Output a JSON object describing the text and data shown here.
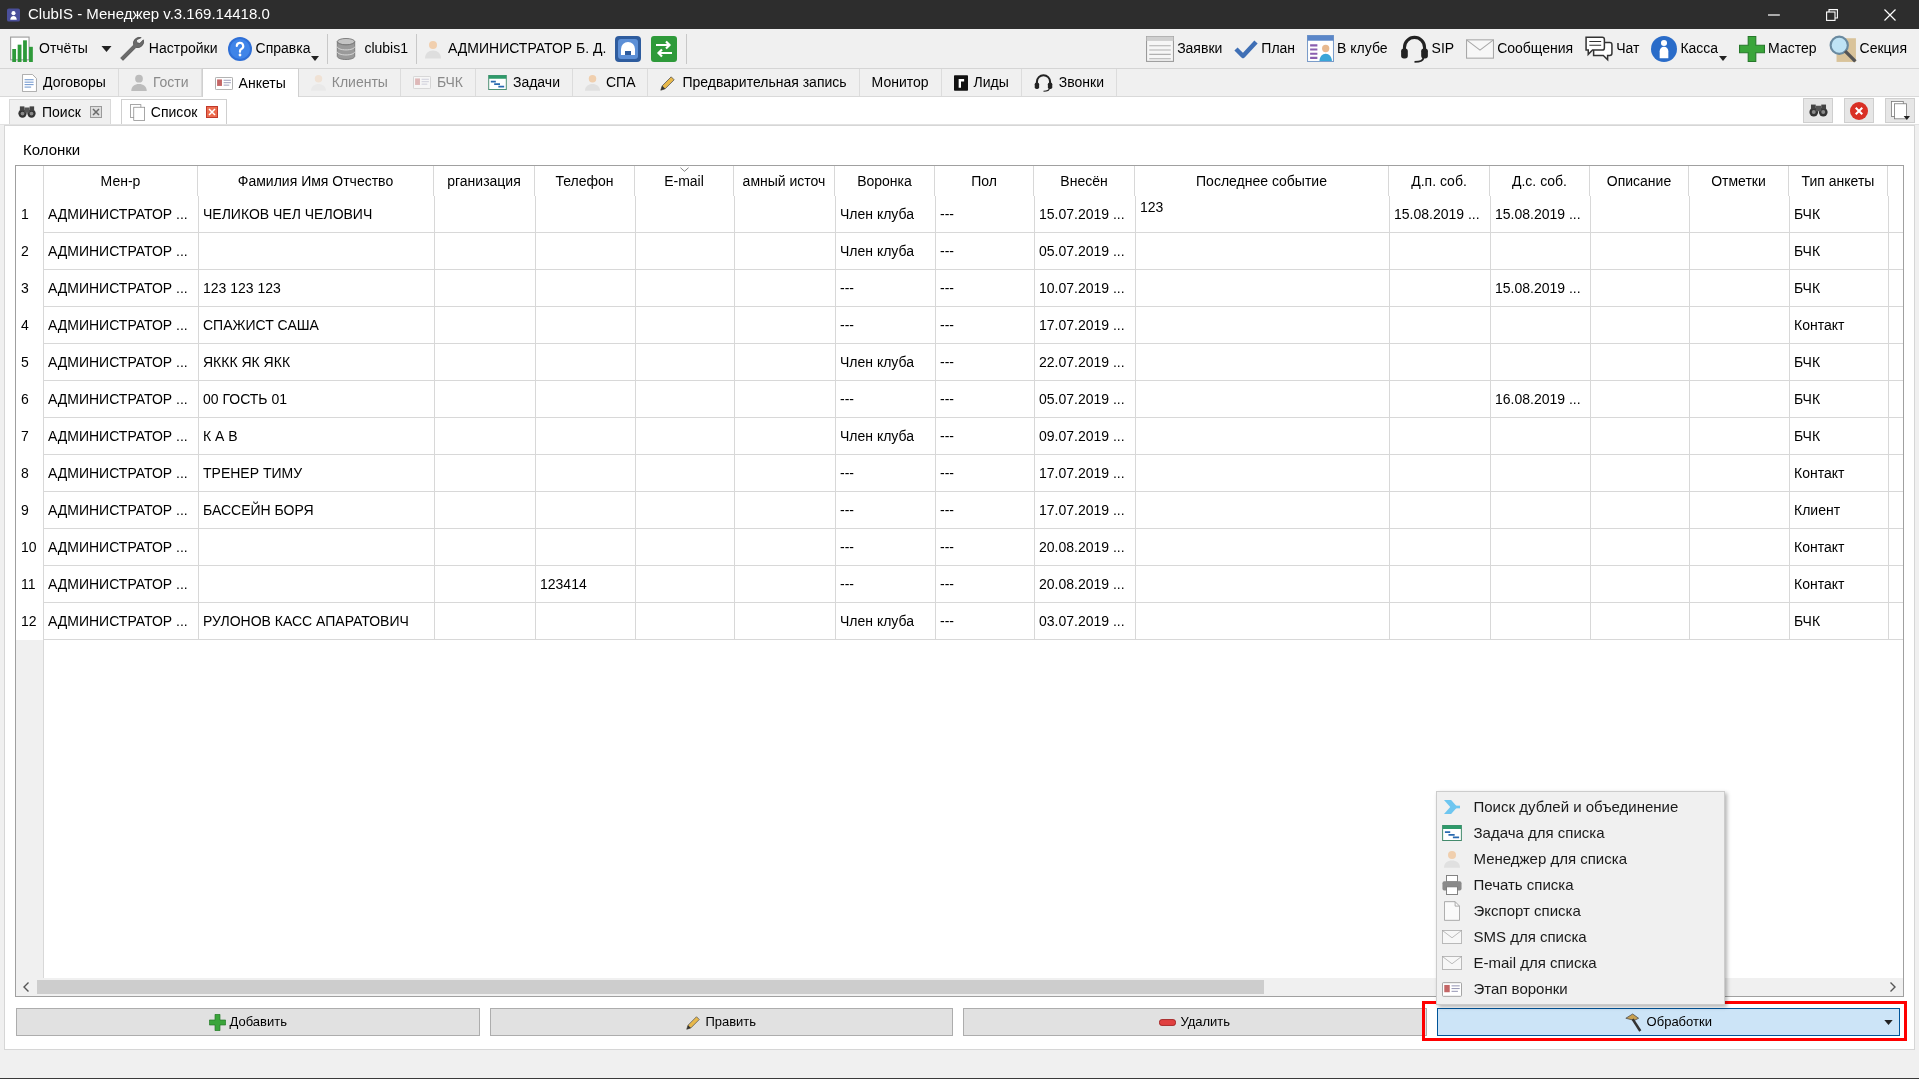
{
  "window": {
    "title": "ClubIS - Менеджер v.3.169.14418.0"
  },
  "toolbar": {
    "left_items": [
      {
        "label": "Отчёты",
        "kind": "split"
      },
      {
        "label": "Настройки",
        "kind": "plain"
      },
      {
        "label": "Справка",
        "kind": "menu"
      }
    ],
    "database": "clubis1",
    "user": "АДМИНИСТРАТОР Б. Д.",
    "right_items": [
      {
        "label": "Заявки",
        "kind": "plain"
      },
      {
        "label": "План",
        "kind": "plain"
      },
      {
        "label": "В клубе",
        "kind": "plain"
      },
      {
        "label": "SIP",
        "kind": "plain"
      },
      {
        "label": "Сообщения",
        "kind": "plain"
      },
      {
        "label": "Чат",
        "kind": "plain"
      },
      {
        "label": "Касса",
        "kind": "menu"
      },
      {
        "label": "Мастер",
        "kind": "plain"
      },
      {
        "label": "Секция",
        "kind": "plain"
      }
    ]
  },
  "tabs": [
    {
      "label": "Договоры",
      "selected": false,
      "disabled": false
    },
    {
      "label": "Гости",
      "selected": false,
      "disabled": true
    },
    {
      "label": "Анкеты",
      "selected": true,
      "disabled": false
    },
    {
      "label": "Клиенты",
      "selected": false,
      "disabled": true
    },
    {
      "label": "БЧК",
      "selected": false,
      "disabled": true
    },
    {
      "label": "Задачи",
      "selected": false,
      "disabled": false
    },
    {
      "label": "СПА",
      "selected": false,
      "disabled": false
    },
    {
      "label": "Предварительная запись",
      "selected": false,
      "disabled": false
    },
    {
      "label": "Монитор",
      "selected": false,
      "disabled": false
    },
    {
      "label": "Лиды",
      "selected": false,
      "disabled": false
    },
    {
      "label": "Звонки",
      "selected": false,
      "disabled": false
    }
  ],
  "subtabs": [
    {
      "label": "Поиск",
      "selected": false
    },
    {
      "label": "Список",
      "selected": true
    }
  ],
  "columns_label": "Колонки",
  "table": {
    "columns": [
      {
        "label": "Мен-р",
        "sorted": false
      },
      {
        "label": "Фамилия Имя Отчество",
        "sorted": false
      },
      {
        "label": "рганизация",
        "sorted": false
      },
      {
        "label": "Телефон",
        "sorted": false
      },
      {
        "label": "E-mail",
        "sorted": true
      },
      {
        "label": "амный источ",
        "sorted": false
      },
      {
        "label": "Воронка",
        "sorted": false
      },
      {
        "label": "Пол",
        "sorted": false
      },
      {
        "label": "Внесён",
        "sorted": false
      },
      {
        "label": "Последнее событие",
        "sorted": false
      },
      {
        "label": "Д.п. соб.",
        "sorted": false
      },
      {
        "label": "Д.с. соб.",
        "sorted": false
      },
      {
        "label": "Описание",
        "sorted": false
      },
      {
        "label": "Отметки",
        "sorted": false
      },
      {
        "label": "Тип анкеты",
        "sorted": false
      }
    ],
    "rows": [
      {
        "number": "1",
        "manager": "АДМИНИСТРАТОР ...",
        "full_name": "ЧЕЛИКОВ ЧЕЛ ЧЕЛОВИЧ",
        "funnel": "Член клуба",
        "gender": "---",
        "created": "15.07.2019 ...",
        "last_event": "123",
        "prev_event_date": "15.08.2019 ...",
        "next_event_date": "15.08.2019 ...",
        "type": "БЧК"
      },
      {
        "number": "2",
        "manager": "АДМИНИСТРАТОР ...",
        "funnel": "Член клуба",
        "gender": "---",
        "created": "05.07.2019 ...",
        "type": "БЧК"
      },
      {
        "number": "3",
        "manager": "АДМИНИСТРАТОР ...",
        "full_name": "123 123 123",
        "funnel": "---",
        "gender": "---",
        "created": "10.07.2019 ...",
        "next_event_date": "15.08.2019 ...",
        "type": "БЧК"
      },
      {
        "number": "4",
        "manager": "АДМИНИСТРАТОР ...",
        "full_name": "СПАЖИСТ САША",
        "funnel": "---",
        "gender": "---",
        "created": "17.07.2019 ...",
        "type": "Контакт"
      },
      {
        "number": "5",
        "manager": "АДМИНИСТРАТОР ...",
        "full_name": "ЯККК ЯК ЯКК",
        "funnel": "Член клуба",
        "gender": "---",
        "created": "22.07.2019 ...",
        "type": "БЧК"
      },
      {
        "number": "6",
        "manager": "АДМИНИСТРАТОР ...",
        "full_name": "00 ГОСТЬ 01",
        "funnel": "---",
        "gender": "---",
        "created": "05.07.2019 ...",
        "next_event_date": "16.08.2019 ...",
        "type": "БЧК"
      },
      {
        "number": "7",
        "manager": "АДМИНИСТРАТОР ...",
        "full_name": "К А В",
        "funnel": "Член клуба",
        "gender": "---",
        "created": "09.07.2019 ...",
        "type": "БЧК"
      },
      {
        "number": "8",
        "manager": "АДМИНИСТРАТОР ...",
        "full_name": "ТРЕНЕР ТИМУ",
        "funnel": "---",
        "gender": "---",
        "created": "17.07.2019 ...",
        "type": "Контакт"
      },
      {
        "number": "9",
        "manager": "АДМИНИСТРАТОР ...",
        "full_name": "БАССЕЙН БОРЯ",
        "funnel": "---",
        "gender": "---",
        "created": "17.07.2019 ...",
        "type": "Клиент"
      },
      {
        "number": "10",
        "manager": "АДМИНИСТРАТОР ...",
        "funnel": "---",
        "gender": "---",
        "created": "20.08.2019 ...",
        "type": "Контакт"
      },
      {
        "number": "11",
        "manager": "АДМИНИСТРАТОР ...",
        "phone": "123414",
        "funnel": "---",
        "gender": "---",
        "created": "20.08.2019 ...",
        "type": "Контакт"
      },
      {
        "number": "12",
        "manager": "АДМИНИСТРАТОР ...",
        "full_name": "РУЛОНОВ КАСС АПАРАТОВИЧ",
        "funnel": "Член клуба",
        "gender": "---",
        "created": "03.07.2019 ...",
        "type": "БЧК"
      }
    ]
  },
  "buttons": [
    "Добавить",
    "Править",
    "Удалить"
  ],
  "actions_button": {
    "label": "Обработки",
    "expanded": true,
    "highlighted": true
  },
  "actions_menu": [
    "Поиск дублей и объединение",
    "Задача для списка",
    "Менеджер для списка",
    "Печать списка",
    "Экспорт списка",
    "SMS для списка",
    "E-mail для списка",
    "Этап воронки"
  ]
}
